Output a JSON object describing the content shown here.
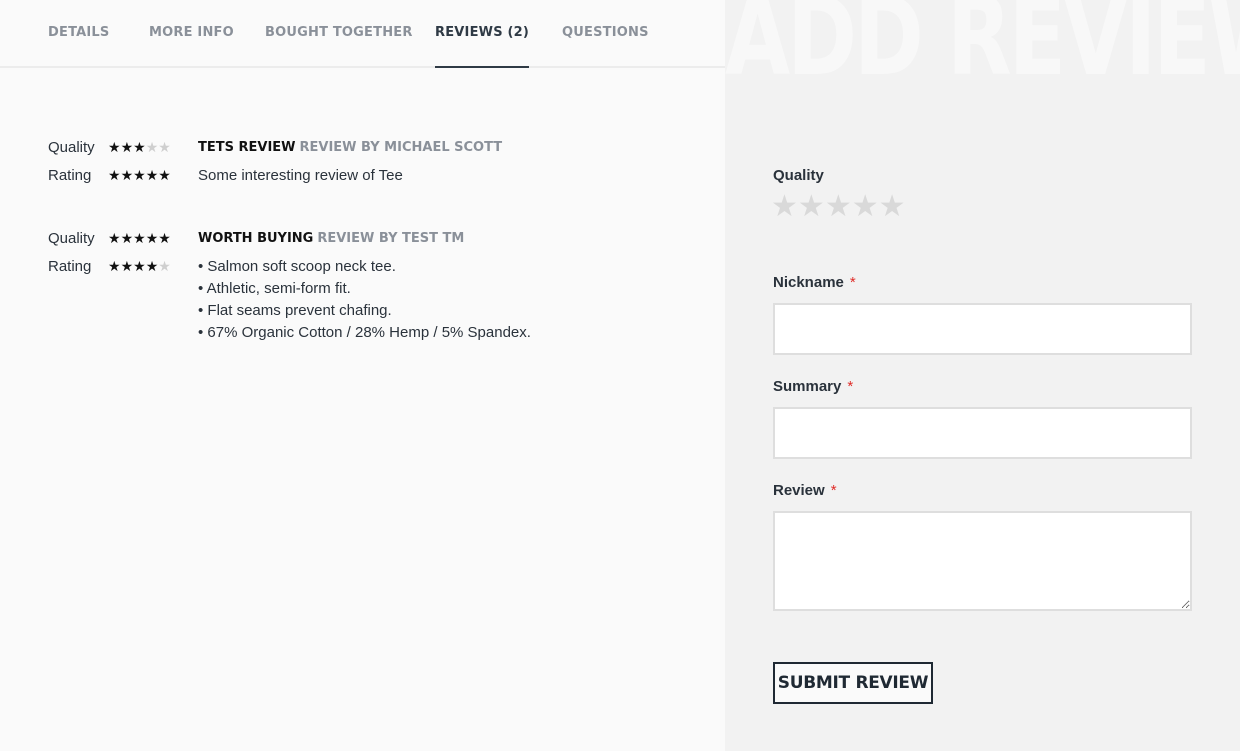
{
  "tabs": [
    {
      "label": "DETAILS"
    },
    {
      "label": "MORE INFO"
    },
    {
      "label": "BOUGHT TOGETHER"
    },
    {
      "label": "REVIEWS (2)",
      "active": true
    },
    {
      "label": "QUESTIONS"
    }
  ],
  "reviews": [
    {
      "title": "TETS REVIEW",
      "by": "REVIEW BY MICHAEL SCOTT",
      "ratings": [
        {
          "label": "Quality",
          "stars": 3,
          "max": 5
        },
        {
          "label": "Rating",
          "stars": 5,
          "max": 5
        }
      ],
      "body": [
        "Some interesting review of Tee"
      ]
    },
    {
      "title": "WORTH BUYING",
      "by": "REVIEW BY TEST TM",
      "ratings": [
        {
          "label": "Quality",
          "stars": 5,
          "max": 5
        },
        {
          "label": "Rating",
          "stars": 4,
          "max": 5
        }
      ],
      "body": [
        "• Salmon soft scoop neck tee.",
        "• Athletic, semi-form fit.",
        "• Flat seams prevent chafing.",
        "• 67% Organic Cotton / 28% Hemp / 5% Spandex."
      ]
    }
  ],
  "form": {
    "bg_title": "ADD REVIEW",
    "quality_label": "Quality",
    "quality_stars_max": 5,
    "nickname_label": "Nickname",
    "summary_label": "Summary",
    "review_label": "Review",
    "required_mark": "*",
    "nickname_value": "",
    "summary_value": "",
    "review_value": "",
    "submit_label": "SUBMIT REVIEW"
  },
  "icons": {
    "star": "star-icon"
  },
  "colors": {
    "required": "#e02b27",
    "star_on": "#111111",
    "star_off": "#cfcfcf",
    "muted": "#8a9099"
  }
}
